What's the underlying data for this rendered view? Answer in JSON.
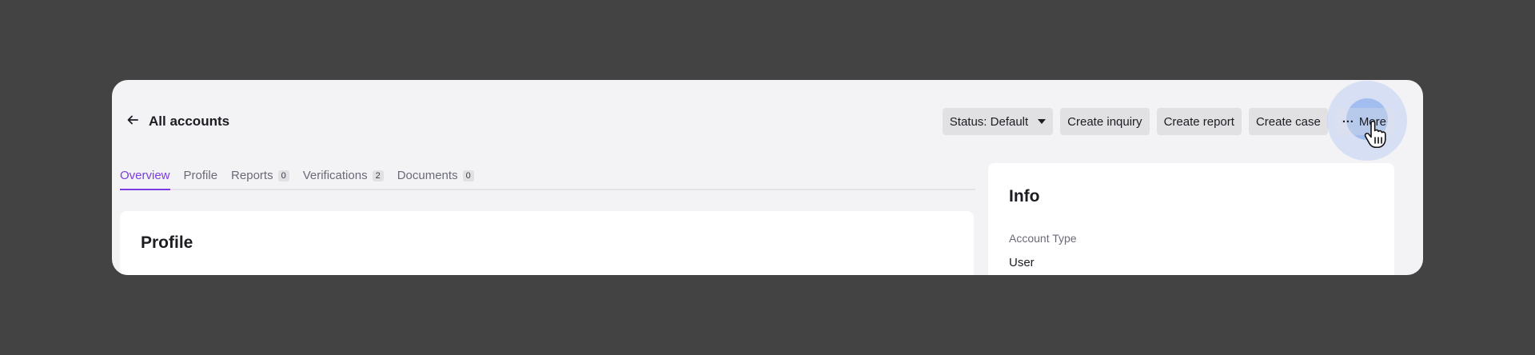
{
  "header": {
    "back_label": "All accounts"
  },
  "actions": {
    "status": "Status: Default",
    "create_inquiry": "Create inquiry",
    "create_report": "Create report",
    "create_case": "Create case",
    "more_dots": "···",
    "more": "More"
  },
  "tabs": [
    {
      "label": "Overview",
      "count": null,
      "active": true
    },
    {
      "label": "Profile",
      "count": null
    },
    {
      "label": "Reports",
      "count": "0"
    },
    {
      "label": "Verifications",
      "count": "2"
    },
    {
      "label": "Documents",
      "count": "0"
    }
  ],
  "main": {
    "profile_title": "Profile"
  },
  "info": {
    "title": "Info",
    "account_type_label": "Account Type",
    "account_type_value": "User"
  },
  "colors": {
    "accent": "#7a3de0",
    "background": "#434343",
    "panel": "#f3f3f5"
  }
}
